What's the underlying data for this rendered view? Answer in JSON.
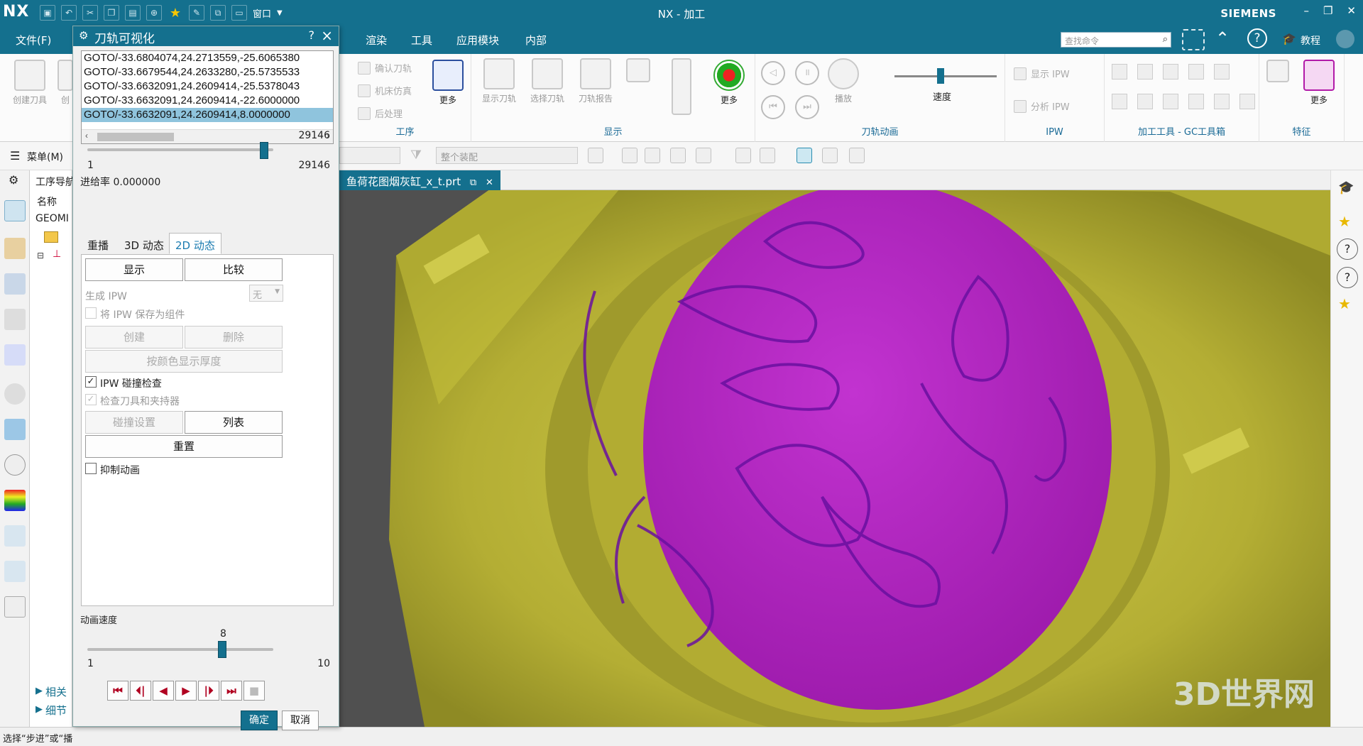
{
  "window": {
    "title": "NX - 加工",
    "logo": "NX",
    "brand": "SIEMENS"
  },
  "menubar": {
    "file": "文件(F)",
    "items": [
      "渲染",
      "工具",
      "应用模块",
      "内部"
    ],
    "search_placeholder": "查找命令",
    "tutorial": "教程",
    "qat_window": "窗口"
  },
  "ribbon": {
    "left_buttons": [
      "创建刀具",
      "创"
    ],
    "proc_small": [
      "确认刀轨",
      "机床仿真",
      "后处理"
    ],
    "proc_group_more": "更多",
    "proc_group_label": "工序",
    "display_buttons": [
      "显示刀轨",
      "选择刀轨",
      "刀轨报告"
    ],
    "display_more": "更多",
    "display_group_label": "显示",
    "anim_buttons": [
      "播放"
    ],
    "anim_speed": "速度",
    "anim_group_label": "刀轨动画",
    "ipw_small": [
      "显示 IPW",
      "分析 IPW"
    ],
    "ipw_group_label": "IPW",
    "gc_group_label": "加工工具 - GC工具箱",
    "feature_more": "更多",
    "feature_group_label": "特征",
    "menu_button": "菜单(M)"
  },
  "toolbar2": {
    "assembly_combo": "整个装配"
  },
  "navigator": {
    "title": "工序导航",
    "col_name": "名称",
    "geom": "GEOMI",
    "section_related": "相关",
    "section_detail": "细节"
  },
  "document_tab": {
    "name": "鱼荷花图烟灰缸_x_t.prt"
  },
  "dialog": {
    "title": "刀轨可视化",
    "goto_lines": [
      "GOTO/-33.6804074,24.2713559,-25.6065380",
      "GOTO/-33.6679544,24.2633280,-25.5735533",
      "GOTO/-33.6632091,24.2609414,-25.5378043",
      "GOTO/-33.6632091,24.2609414,-22.6000000",
      "GOTO/-33.6632091,24.2609414,8.0000000"
    ],
    "selected_line_index": 4,
    "motion_slider": {
      "value": 29146,
      "min": 1,
      "max": 29146
    },
    "feed_rate": "进给率 0.000000",
    "tabs": [
      "重播",
      "3D 动态",
      "2D 动态"
    ],
    "active_tab": "2D 动态",
    "buttons": {
      "show": "显示",
      "compare": "比较",
      "create": "创建",
      "delete": "删除",
      "thickness_by_color": "按颜色显示厚度",
      "collision_settings": "碰撞设置",
      "list": "列表",
      "reset": "重置",
      "ok": "确定",
      "cancel": "取消"
    },
    "ipw": {
      "label": "生成 IPW",
      "value": "无",
      "save_as_component": "将 IPW 保存为组件"
    },
    "ipw_collision_check": {
      "label": "IPW 碰撞检查",
      "checked": true
    },
    "check_tool_holder": {
      "label": "检查刀具和夹持器",
      "checked": true
    },
    "suppress_animation": {
      "label": "抑制动画",
      "checked": false
    },
    "animation_speed": {
      "label": "动画速度",
      "value": 8,
      "min": 1,
      "max": 10
    },
    "min_label": "1",
    "max_label": "10",
    "motion_min_label": "1",
    "motion_max_label": "29146",
    "motion_value_label": "29146",
    "speed_value_label": "8"
  },
  "status": {
    "text": "选择“步进”或“播"
  },
  "watermark": "3D世界网",
  "colors": {
    "accent": "#14708e",
    "part_yellow": "#b8b436",
    "relief_magenta": "#b427c4"
  }
}
